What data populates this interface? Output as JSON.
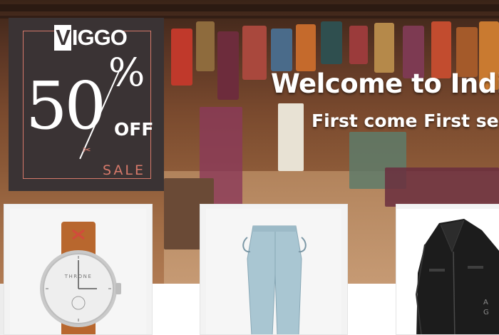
{
  "hero": {
    "title": "Welcome to Indi",
    "subtitle": "First come First ser"
  },
  "promo": {
    "brand_v": "V",
    "brand_rest": "IGGO",
    "discount_number": "50",
    "percent_sign": "%",
    "off_label": "OFF",
    "sale_label": "SALE"
  },
  "products": [
    {
      "name": "watch",
      "strap_text": "THRONE"
    },
    {
      "name": "jeans"
    },
    {
      "name": "leather-jacket"
    }
  ],
  "overlay_text": {
    "line1": "A",
    "line2": "G"
  },
  "colors": {
    "promo_bg": "#3a3334",
    "promo_accent": "#d6796a",
    "strap": "#b8672e",
    "denim": "#a9c6d2",
    "jacket": "#1c1c1c"
  }
}
